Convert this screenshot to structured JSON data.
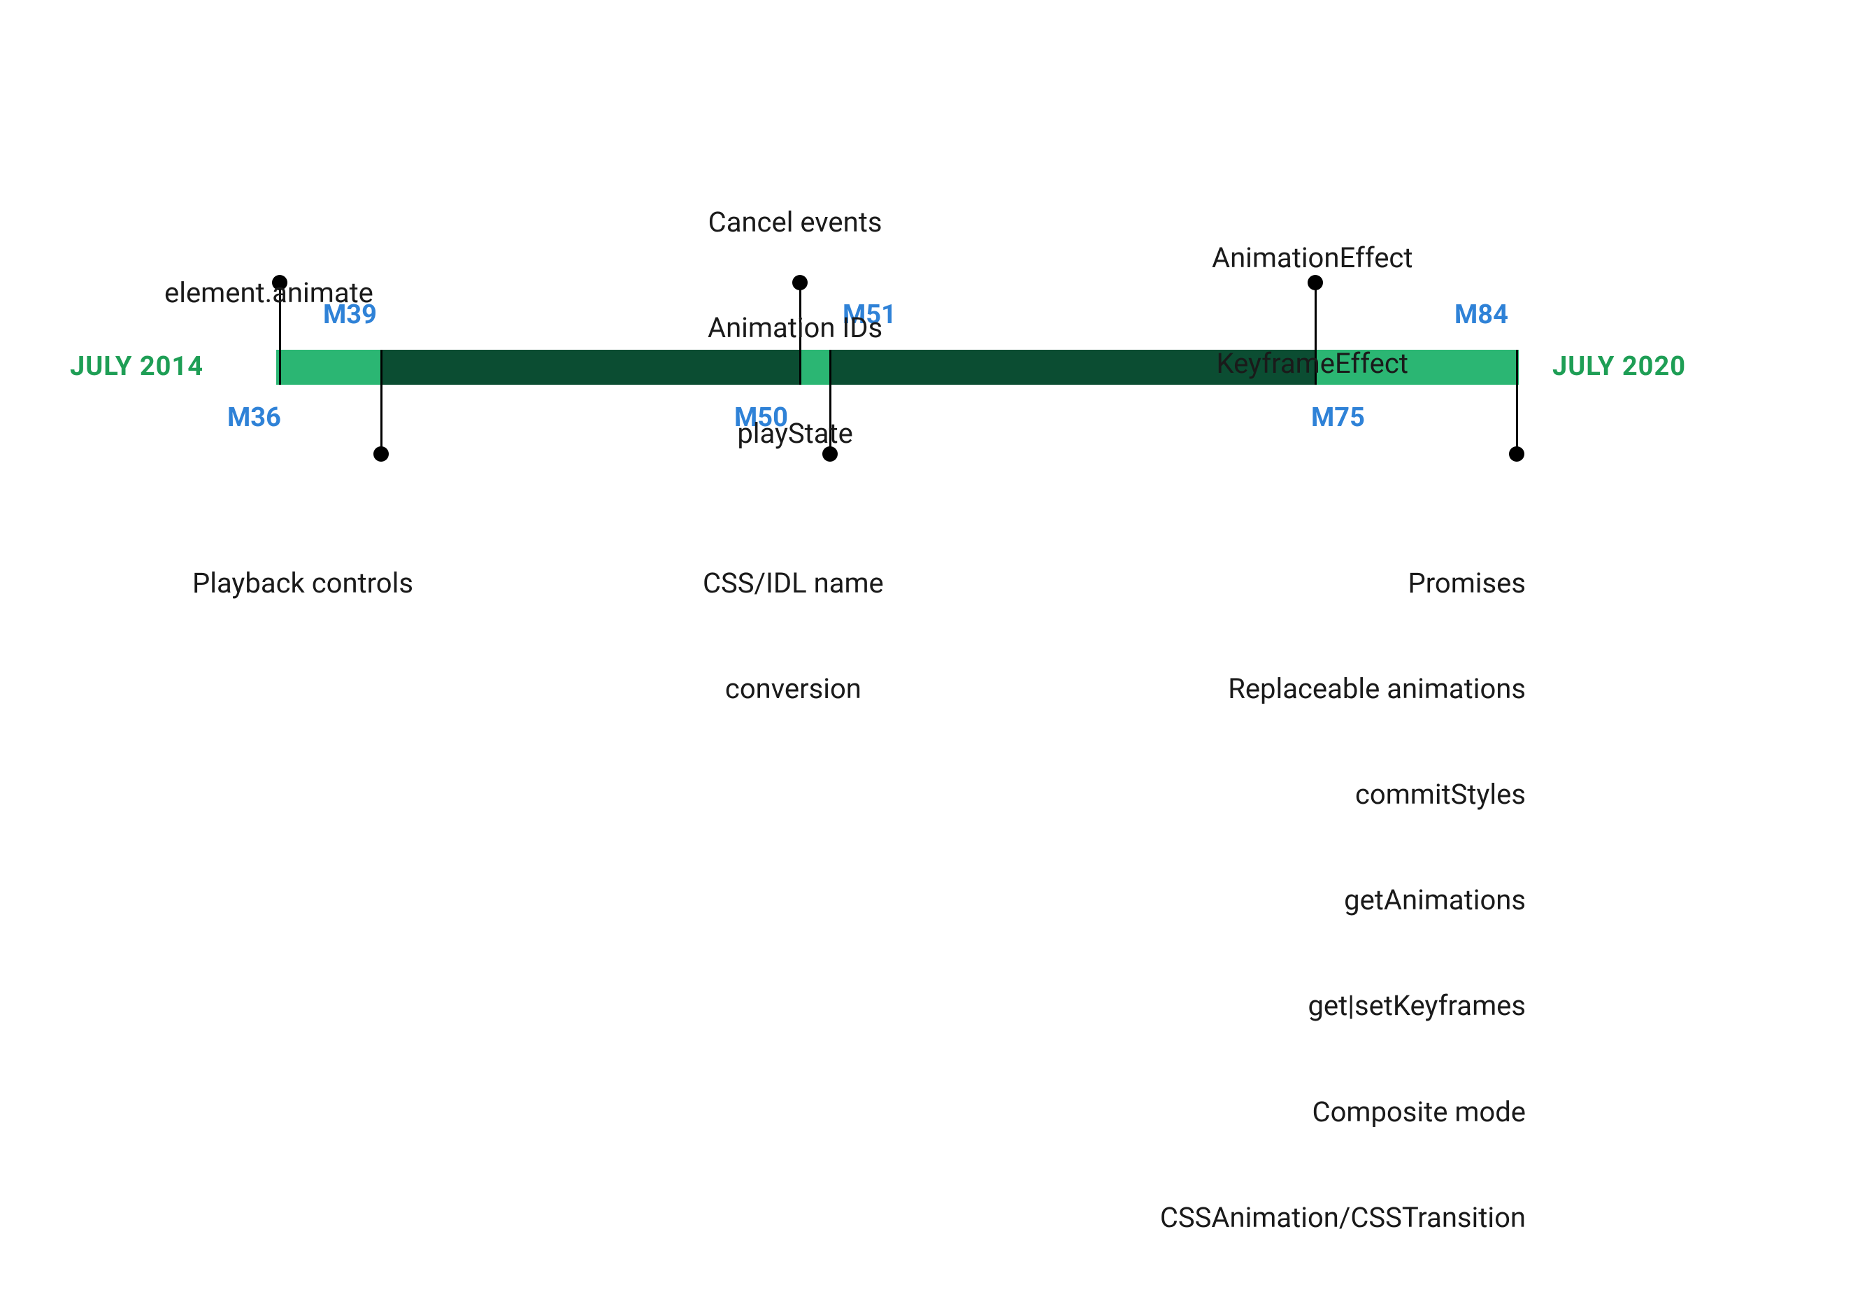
{
  "start_label": "JULY 2014",
  "end_label": "JULY 2020",
  "milestones": {
    "m36": {
      "version": "M36",
      "text": [
        "element.animate"
      ]
    },
    "m39": {
      "version": "M39",
      "text": [
        "Playback controls"
      ]
    },
    "m50": {
      "version": "M50",
      "text": [
        "CSS/IDL name",
        "conversion"
      ]
    },
    "m51": {
      "version": "M51",
      "text": [
        "Cancel events",
        "Animation IDs",
        "playState"
      ]
    },
    "m75": {
      "version": "M75",
      "text": [
        "AnimationEffect",
        "KeyframeEffect"
      ]
    },
    "m84": {
      "version": "M84",
      "text": [
        "Promises",
        "Replaceable animations",
        "commitStyles",
        "getAnimations",
        "get|setKeyframes",
        "Composite mode",
        "CSSAnimation/CSSTransition"
      ]
    }
  },
  "colors": {
    "light_green": "#2bb673",
    "dark_green": "#0b4d32",
    "blue": "#2f82d7",
    "green_text": "#1e9e55"
  },
  "chart_data": {
    "type": "timeline",
    "title": "",
    "start": "July 2014",
    "end": "July 2020",
    "events": [
      {
        "version": "M36",
        "position": "above",
        "features": [
          "element.animate"
        ]
      },
      {
        "version": "M39",
        "position": "below",
        "features": [
          "Playback controls"
        ]
      },
      {
        "version": "M50",
        "position": "below",
        "features": [
          "CSS/IDL name conversion"
        ]
      },
      {
        "version": "M51",
        "position": "above",
        "features": [
          "Cancel events",
          "Animation IDs",
          "playState"
        ]
      },
      {
        "version": "M75",
        "position": "above",
        "features": [
          "AnimationEffect",
          "KeyframeEffect"
        ]
      },
      {
        "version": "M84",
        "position": "below",
        "features": [
          "Promises",
          "Replaceable animations",
          "commitStyles",
          "getAnimations",
          "get|setKeyframes",
          "Composite mode",
          "CSSAnimation/CSSTransition"
        ]
      }
    ]
  }
}
